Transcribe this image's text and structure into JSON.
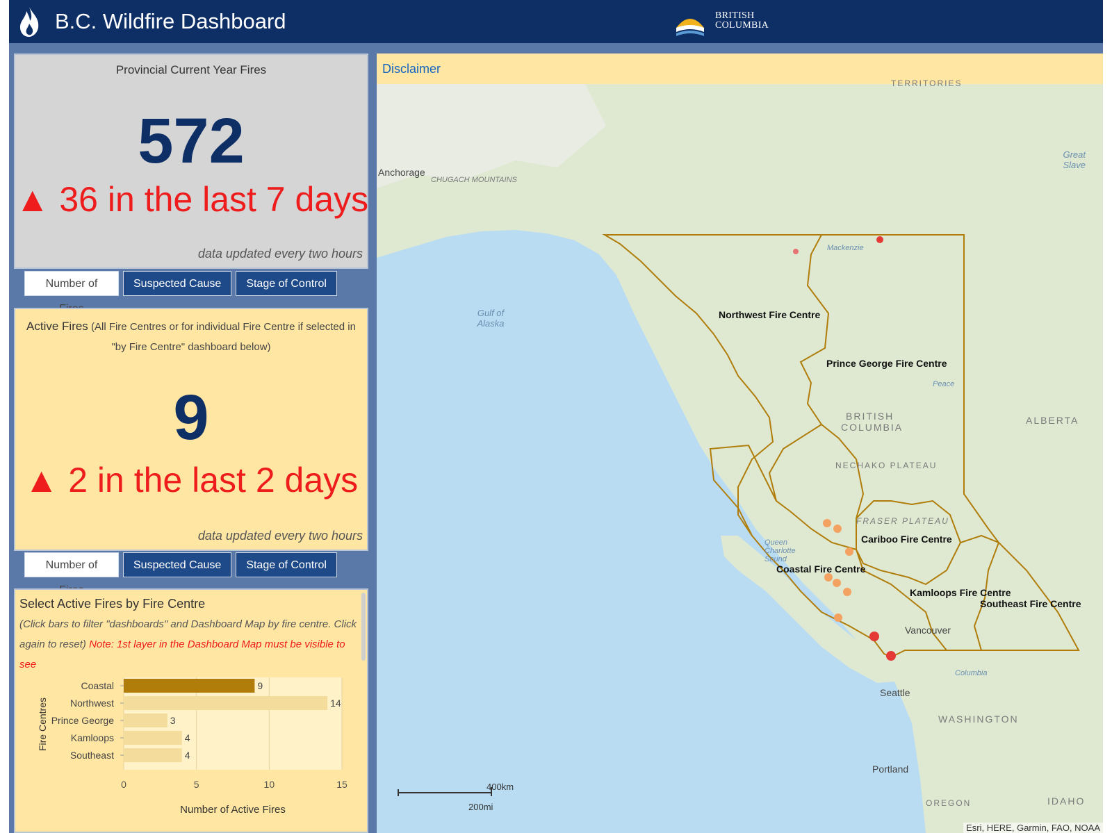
{
  "header": {
    "title": "B.C. Wildfire Dashboard",
    "logo_text_1": "BRITISH",
    "logo_text_2": "COLUMBIA",
    "colors": {
      "header_bg": "#0e2f66",
      "accent_red": "#ee1c1c",
      "panel_yellow": "#ffe6a3",
      "bar_highlight": "#b07d0a"
    }
  },
  "provincial": {
    "title": "Provincial Current Year Fires",
    "count": "572",
    "delta_text": "▲ 36 in the last 7 days",
    "updated_note": "data updated every two hours",
    "tabs": [
      "Number of Fires",
      "Suspected Cause",
      "Stage of Control"
    ],
    "active_tab": "Number of Fires"
  },
  "active_fires": {
    "title_bold": "Active Fires",
    "title_rest": "(All Fire Centres or for individual Fire Centre if selected in \"by Fire Centre\" dashboard below)",
    "count": "9",
    "delta_text": "▲ 2 in the last 2 days",
    "updated_note": "data updated every two hours",
    "tabs": [
      "Number of Fires",
      "Suspected Cause",
      "Stage of Control"
    ],
    "active_tab": "Number of Fires"
  },
  "by_centre": {
    "title": "Select Active Fires by Fire Centre",
    "note_1": "(Click bars to filter \"dashboards\" and Dashboard Map by fire centre.  Click again to reset)",
    "note_2": "Note: 1st layer in the Dashboard Map must be visible to see"
  },
  "chart_data": {
    "type": "bar",
    "orientation": "horizontal",
    "categories": [
      "Coastal",
      "Northwest",
      "Prince George",
      "Kamloops",
      "Southeast"
    ],
    "values": [
      9,
      14,
      3,
      4,
      4
    ],
    "highlighted": "Coastal",
    "xlabel": "Number of Active Fires",
    "ylabel": "Fire Centres",
    "xlim": [
      0,
      15
    ],
    "xticks": [
      0,
      5,
      10,
      15
    ],
    "grid": true
  },
  "map": {
    "disclaimer": "Disclaimer",
    "fire_centres": [
      "Northwest Fire Centre",
      "Prince George Fire Centre",
      "Cariboo Fire Centre",
      "Coastal Fire Centre",
      "Kamloops Fire Centre",
      "Southeast Fire Centre"
    ],
    "regions": [
      "BRITISH",
      "COLUMBIA",
      "ALBERTA",
      "NECHAKO PLATEAU",
      "FRASER PLATEAU",
      "WASHINGTON",
      "IDAHO",
      "OREGON",
      "TERRITORIES",
      "CHUGACH MOUNTAINS"
    ],
    "cities": [
      "Anchorage",
      "Vancouver",
      "Seattle",
      "Portland"
    ],
    "water": [
      "Gulf of Alaska",
      "Great Slave",
      "Queen Charlotte Sound",
      "Mackenzie",
      "Peace",
      "Columbia"
    ],
    "scale_km": "400km",
    "scale_mi": "200mi",
    "attribution": "Esri, HERE, Garmin, FAO, NOAA"
  }
}
